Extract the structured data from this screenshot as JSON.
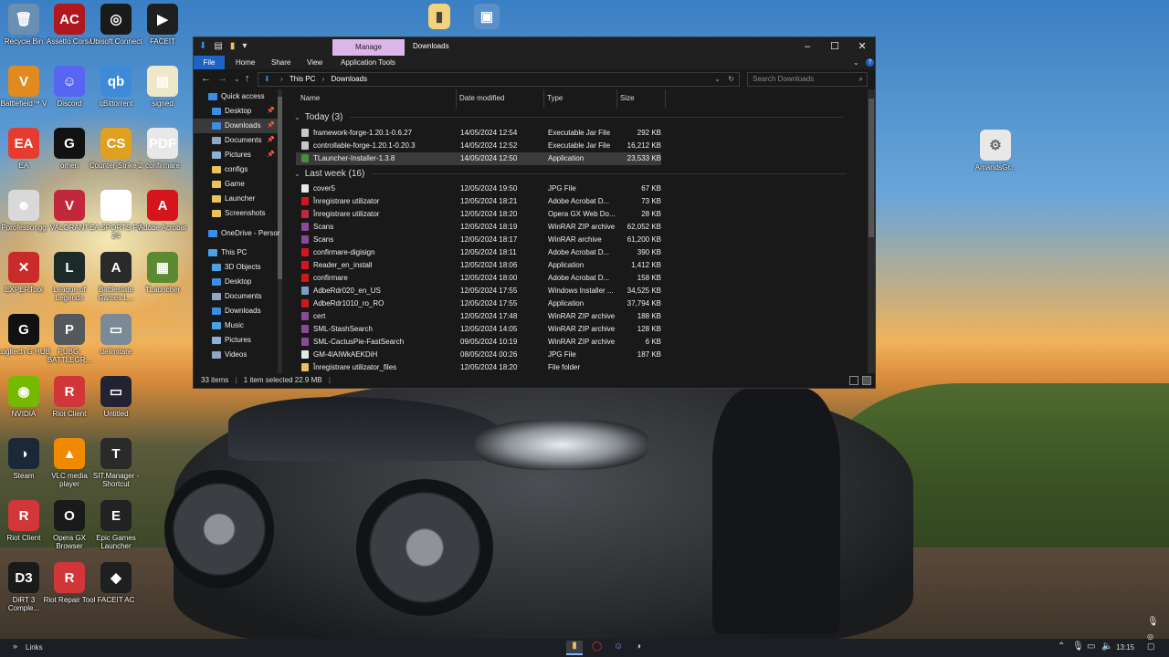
{
  "desktop_left": [
    {
      "label": "Recycle Bin",
      "icon": "recycle-bin-icon",
      "color": "#6b8fb3",
      "glyph": "🗑"
    },
    {
      "label": "Assetto Corsa",
      "icon": "assetto-corsa-icon",
      "color": "#b0171f",
      "glyph": "AC"
    },
    {
      "label": "Ubisoft Connect",
      "icon": "ubisoft-icon",
      "color": "#1a1a1a",
      "glyph": "◎"
    },
    {
      "label": "FACEIT",
      "icon": "faceit-icon",
      "color": "#1f1f1f",
      "glyph": "▶"
    },
    {
      "label": "Battlefield™ V",
      "icon": "battlefield-icon",
      "color": "#e08a20",
      "glyph": "V"
    },
    {
      "label": "Discord",
      "icon": "discord-icon",
      "color": "#5865f2",
      "glyph": "☺"
    },
    {
      "label": "qBittorrent",
      "icon": "qbittorrent-icon",
      "color": "#3d8ad6",
      "glyph": "qb"
    },
    {
      "label": "signed",
      "icon": "pdf-file-icon",
      "color": "#f0e6c8",
      "glyph": "▤"
    },
    {
      "label": "EA",
      "icon": "ea-icon",
      "color": "#e43c2f",
      "glyph": "EA"
    },
    {
      "label": "omen",
      "icon": "omen-icon",
      "color": "#111111",
      "glyph": "G"
    },
    {
      "label": "Counter-Strike 2",
      "icon": "counter-strike-icon",
      "color": "#e0a020",
      "glyph": "CS"
    },
    {
      "label": "confirmare",
      "icon": "pdf-icon",
      "color": "#e8e8e8",
      "glyph": "PDF"
    },
    {
      "label": "Porofessor.gg",
      "icon": "porofessor-icon",
      "color": "#d9d9d9",
      "glyph": "☻"
    },
    {
      "label": "VALORANT",
      "icon": "valorant-icon",
      "color": "#c2283b",
      "glyph": "V"
    },
    {
      "label": "EA SPORTS FC 24",
      "icon": "fc24-icon",
      "color": "#ffffff",
      "glyph": "FC"
    },
    {
      "label": "Adobe Acrobat",
      "icon": "adobe-acrobat-icon",
      "color": "#d4161c",
      "glyph": "A"
    },
    {
      "label": "EXPERTool",
      "icon": "expertool-icon",
      "color": "#c92a2a",
      "glyph": "✕"
    },
    {
      "label": "League of Legends",
      "icon": "league-icon",
      "color": "#1d2a2a",
      "glyph": "L"
    },
    {
      "label": "Battlestate Games L...",
      "icon": "battlestate-icon",
      "color": "#2a2a2a",
      "glyph": "A"
    },
    {
      "label": "TLauncher",
      "icon": "tlauncher-icon",
      "color": "#5b8a33",
      "glyph": "▦"
    },
    {
      "label": "Logitech G HUB",
      "icon": "logitech-icon",
      "color": "#111111",
      "glyph": "G"
    },
    {
      "label": "PUBG: BATTLEGR...",
      "icon": "pubg-icon",
      "color": "#55595c",
      "glyph": "P"
    },
    {
      "label": "delimitare",
      "icon": "image-file-icon",
      "color": "#7b8a96",
      "glyph": "▭"
    },
    {
      "label": "",
      "icon": "blank-icon",
      "color": "transparent",
      "glyph": ""
    },
    {
      "label": "NVIDIA",
      "icon": "nvidia-icon",
      "color": "#76b900",
      "glyph": "◉"
    },
    {
      "label": "Riot Client",
      "icon": "riot-client-icon",
      "color": "#d13639",
      "glyph": "R"
    },
    {
      "label": "Untitled",
      "icon": "image-file-icon",
      "color": "#223",
      "glyph": "▭"
    },
    {
      "label": "",
      "icon": "blank-icon",
      "color": "transparent",
      "glyph": ""
    },
    {
      "label": "Steam",
      "icon": "steam-icon",
      "color": "#1b2838",
      "glyph": "◑"
    },
    {
      "label": "VLC media player",
      "icon": "vlc-icon",
      "color": "#f08a00",
      "glyph": "▲"
    },
    {
      "label": "SIT.Manager - Shortcut",
      "icon": "sit-manager-icon",
      "color": "#2a2a2a",
      "glyph": "T"
    },
    {
      "label": "",
      "icon": "blank-icon",
      "color": "transparent",
      "glyph": ""
    },
    {
      "label": "Riot Client",
      "icon": "riot-client-icon",
      "color": "#d13639",
      "glyph": "R"
    },
    {
      "label": "Opera GX Browser",
      "icon": "opera-gx-icon",
      "color": "#1a1a1a",
      "glyph": "O"
    },
    {
      "label": "Epic Games Launcher",
      "icon": "epic-games-icon",
      "color": "#222222",
      "glyph": "E"
    },
    {
      "label": "",
      "icon": "blank-icon",
      "color": "transparent",
      "glyph": ""
    },
    {
      "label": "DiRT 3 Comple...",
      "icon": "dirt3-icon",
      "color": "#1a1a1a",
      "glyph": "D3"
    },
    {
      "label": "Riot Repair Tool",
      "icon": "riot-repair-icon",
      "color": "#d13639",
      "glyph": "R"
    },
    {
      "label": "FACEIT AC",
      "icon": "faceit-ac-icon",
      "color": "#1f1f1f",
      "glyph": "◆"
    }
  ],
  "desktop_extra": [
    {
      "label": "AmandsGr...",
      "icon": "settings-file-icon"
    }
  ],
  "explorer": {
    "manage_tab": "Manage",
    "title": "Downloads",
    "ribbon_tabs": [
      "File",
      "Home",
      "Share",
      "View",
      "Application Tools"
    ],
    "breadcrumb": [
      "This PC",
      "Downloads"
    ],
    "search_placeholder": "Search Downloads",
    "tree": [
      {
        "label": "Quick access",
        "icon": "star-icon",
        "color": "#3a8ee6",
        "indent": 0
      },
      {
        "label": "Desktop",
        "icon": "desktop-folder-icon",
        "color": "#3a8ee6",
        "indent": 1,
        "pin": true
      },
      {
        "label": "Downloads",
        "icon": "downloads-folder-icon",
        "color": "#3a8ee6",
        "indent": 1,
        "pin": true,
        "selected": true
      },
      {
        "label": "Documents",
        "icon": "documents-folder-icon",
        "color": "#8fa7c2",
        "indent": 1,
        "pin": true
      },
      {
        "label": "Pictures",
        "icon": "pictures-folder-icon",
        "color": "#8fb0d6",
        "indent": 1,
        "pin": true
      },
      {
        "label": "configs",
        "icon": "folder-icon",
        "color": "#e8c25a",
        "indent": 1
      },
      {
        "label": "Game",
        "icon": "folder-icon",
        "color": "#e8c25a",
        "indent": 1
      },
      {
        "label": "Launcher",
        "icon": "folder-icon",
        "color": "#e8c25a",
        "indent": 1
      },
      {
        "label": "Screenshots",
        "icon": "folder-icon",
        "color": "#e8c25a",
        "indent": 1
      },
      {
        "label": "OneDrive - Persor",
        "icon": "onedrive-icon",
        "color": "#3a8ee6",
        "indent": 0
      },
      {
        "label": "This PC",
        "icon": "computer-icon",
        "color": "#4aa3e8",
        "indent": 0
      },
      {
        "label": "3D Objects",
        "icon": "3d-objects-icon",
        "color": "#4aa3e8",
        "indent": 1
      },
      {
        "label": "Desktop",
        "icon": "desktop-folder-icon",
        "color": "#3a8ee6",
        "indent": 1
      },
      {
        "label": "Documents",
        "icon": "documents-folder-icon",
        "color": "#8fa7c2",
        "indent": 1
      },
      {
        "label": "Downloads",
        "icon": "downloads-folder-icon",
        "color": "#3a8ee6",
        "indent": 1
      },
      {
        "label": "Music",
        "icon": "music-folder-icon",
        "color": "#4aa3e8",
        "indent": 1
      },
      {
        "label": "Pictures",
        "icon": "pictures-folder-icon",
        "color": "#8fb0d6",
        "indent": 1
      },
      {
        "label": "Videos",
        "icon": "videos-folder-icon",
        "color": "#8fa7c2",
        "indent": 1
      }
    ],
    "columns": [
      "Name",
      "Date modified",
      "Type",
      "Size"
    ],
    "groups": [
      {
        "label": "Today (3)",
        "files": [
          {
            "name": "framework-forge-1.20.1-0.6.27",
            "date": "14/05/2024 12:54",
            "type": "Executable Jar File",
            "size": "292 KB",
            "icon": "jar-file-icon",
            "color": "#c7c7c7"
          },
          {
            "name": "controllable-forge-1.20.1-0.20.3",
            "date": "14/05/2024 12:52",
            "type": "Executable Jar File",
            "size": "16,212 KB",
            "icon": "jar-file-icon",
            "color": "#c7c7c7"
          },
          {
            "name": "TLauncher-Installer-1.3.8",
            "date": "14/05/2024 12:50",
            "type": "Application",
            "size": "23,533 KB",
            "icon": "tlauncher-app-icon",
            "color": "#4c8c3a",
            "selected": true
          }
        ]
      },
      {
        "label": "Last week (16)",
        "files": [
          {
            "name": "cover5",
            "date": "12/05/2024 19:50",
            "type": "JPG File",
            "size": "67 KB",
            "icon": "jpg-file-icon",
            "color": "#e8e8e8"
          },
          {
            "name": "Înregistrare utilizator",
            "date": "12/05/2024 18:21",
            "type": "Adobe Acrobat D...",
            "size": "73 KB",
            "icon": "pdf-file-icon",
            "color": "#d4161c"
          },
          {
            "name": "Înregistrare utilizator",
            "date": "12/05/2024 18:20",
            "type": "Opera GX Web Do...",
            "size": "28 KB",
            "icon": "opera-gx-file-icon",
            "color": "#c2283b"
          },
          {
            "name": "Scans",
            "date": "12/05/2024 18:19",
            "type": "WinRAR ZIP archive",
            "size": "62,052 KB",
            "icon": "winrar-icon",
            "color": "#8a4a9a"
          },
          {
            "name": "Scans",
            "date": "12/05/2024 18:17",
            "type": "WinRAR archive",
            "size": "61,200 KB",
            "icon": "winrar-icon",
            "color": "#8a4a9a"
          },
          {
            "name": "confirmare-digisign",
            "date": "12/05/2024 18:11",
            "type": "Adobe Acrobat D...",
            "size": "390 KB",
            "icon": "pdf-file-icon",
            "color": "#d4161c"
          },
          {
            "name": "Reader_en_install",
            "date": "12/05/2024 18:06",
            "type": "Application",
            "size": "1,412 KB",
            "icon": "acrobat-installer-icon",
            "color": "#d4161c"
          },
          {
            "name": "confirmare",
            "date": "12/05/2024 18:00",
            "type": "Adobe Acrobat D...",
            "size": "158 KB",
            "icon": "pdf-file-icon",
            "color": "#d4161c"
          },
          {
            "name": "AdbeRdr020_en_US",
            "date": "12/05/2024 17:55",
            "type": "Windows Installer ...",
            "size": "34,525 KB",
            "icon": "msi-file-icon",
            "color": "#7f9fc2"
          },
          {
            "name": "AdbeRdr1010_ro_RO",
            "date": "12/05/2024 17:55",
            "type": "Application",
            "size": "37,794 KB",
            "icon": "acrobat-installer-icon",
            "color": "#d4161c"
          },
          {
            "name": "cert",
            "date": "12/05/2024 17:48",
            "type": "WinRAR ZIP archive",
            "size": "188 KB",
            "icon": "winrar-icon",
            "color": "#8a4a9a"
          },
          {
            "name": "SML-StashSearch",
            "date": "12/05/2024 14:05",
            "type": "WinRAR ZIP archive",
            "size": "128 KB",
            "icon": "winrar-icon",
            "color": "#8a4a9a"
          },
          {
            "name": "SML-CactusPie-FastSearch",
            "date": "09/05/2024 10:19",
            "type": "WinRAR ZIP archive",
            "size": "6 KB",
            "icon": "winrar-icon",
            "color": "#8a4a9a"
          },
          {
            "name": "GM-4lAIWkAEKDiH",
            "date": "08/05/2024 00:26",
            "type": "JPG File",
            "size": "187 KB",
            "icon": "jpg-file-icon",
            "color": "#e8e8e8"
          },
          {
            "name": "Înregistrare utilizator_files",
            "date": "12/05/2024 18:20",
            "type": "File folder",
            "size": "",
            "icon": "folder-icon",
            "color": "#e8c25a"
          }
        ]
      }
    ],
    "status": {
      "count": "33 items",
      "selection": "1 item selected  22.9 MB"
    }
  },
  "taskbar": {
    "links_label": "Links",
    "time": "13:15"
  }
}
